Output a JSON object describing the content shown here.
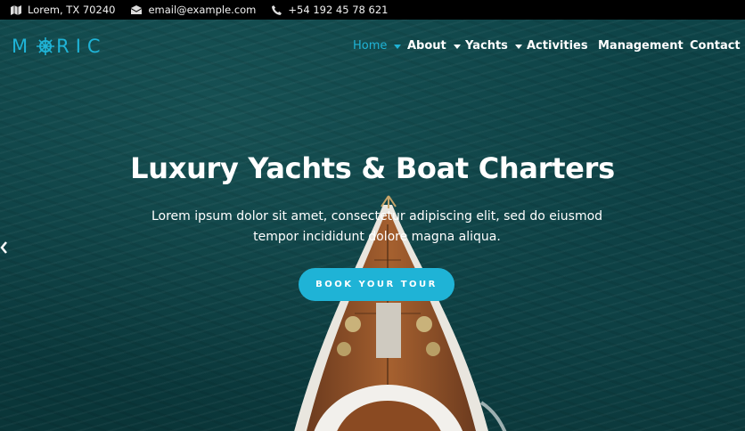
{
  "topbar": {
    "address": "Lorem, TX 70240",
    "email": "email@example.com",
    "phone": "+54 192 45 78 621"
  },
  "brand": {
    "logo_left": "M",
    "logo_right": "RIC",
    "accent": "#1fb3d6"
  },
  "nav": {
    "items": [
      {
        "label": "Home",
        "active": true,
        "dropdown": true
      },
      {
        "label": "About",
        "active": false,
        "dropdown": true
      },
      {
        "label": "Yachts",
        "active": false,
        "dropdown": true
      },
      {
        "label": "Activities",
        "active": false,
        "dropdown": false
      },
      {
        "label": "Management",
        "active": false,
        "dropdown": false
      },
      {
        "label": "Contact",
        "active": false,
        "dropdown": false
      }
    ]
  },
  "hero": {
    "title": "Luxury Yachts & Boat Charters",
    "subtitle": "Lorem ipsum dolor sit amet, consectetur adipiscing elit, sed do eiusmod tempor incididunt dolore magna aliqua.",
    "cta_label": "BOOK YOUR TOUR"
  },
  "icons": {
    "address": "map-icon",
    "email": "envelope-icon",
    "phone": "phone-icon",
    "logo": "ship-wheel-icon",
    "carousel_prev": "chevron-left-icon"
  }
}
